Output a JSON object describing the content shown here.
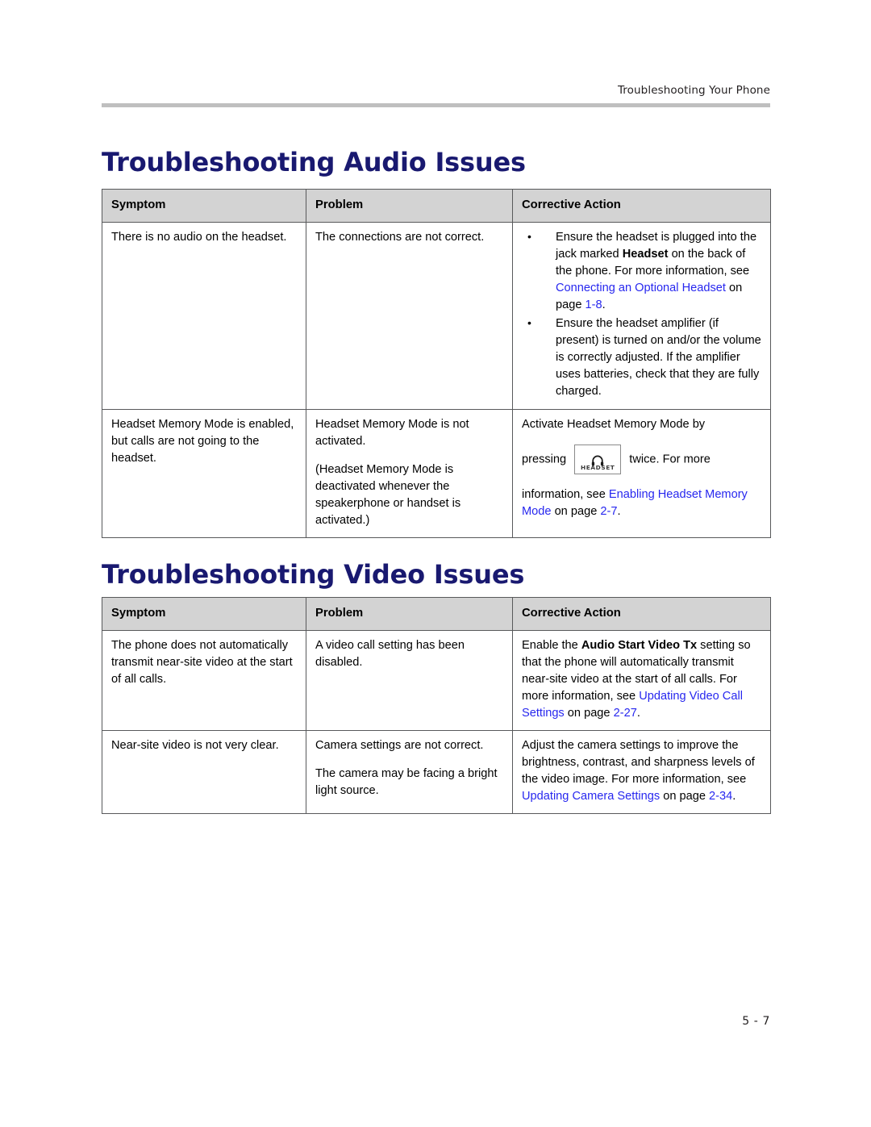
{
  "page": {
    "running_header": "Troubleshooting Your Phone",
    "folio": "5 - 7",
    "colors": {
      "heading_blue": "#191970",
      "link_blue": "#2727ef",
      "table_header_gray": "#d3d3d3",
      "rule_gray": "#bfbfbf",
      "border_gray": "#58595b"
    }
  },
  "sections": [
    {
      "heading": "Troubleshooting Audio Issues",
      "table": {
        "columns": [
          "Symptom",
          "Problem",
          "Corrective Action"
        ],
        "rows": [
          {
            "symptom": "There is no audio on the headset.",
            "problem": "The connections are not correct.",
            "action_bullets": [
              {
                "parts": [
                  {
                    "t": "Ensure the headset is plugged into the jack marked ",
                    "style": "normal"
                  },
                  {
                    "t": "Headset",
                    "style": "bold"
                  },
                  {
                    "t": " on the back of the phone. For more information, see ",
                    "style": "normal"
                  },
                  {
                    "t": "Connecting an Optional Headset",
                    "style": "link"
                  },
                  {
                    "t": " on page ",
                    "style": "normal"
                  },
                  {
                    "t": "1-8",
                    "style": "link"
                  },
                  {
                    "t": ".",
                    "style": "normal"
                  }
                ]
              },
              {
                "parts": [
                  {
                    "t": "Ensure the headset amplifier (if present) is turned on and/or the volume is correctly adjusted. If the amplifier uses batteries, check that they are fully charged.",
                    "style": "normal"
                  }
                ]
              }
            ]
          },
          {
            "symptom": "Headset Memory Mode is enabled, but calls are not going to the headset.",
            "problem_paragraphs": [
              "Headset Memory Mode is not activated.",
              "(Headset Memory Mode is deactivated whenever the speakerphone or handset is activated.)"
            ],
            "action_paragraphs": [
              {
                "parts": [
                  {
                    "t": "Activate Headset Memory Mode by",
                    "style": "normal"
                  }
                ]
              },
              {
                "parts": [
                  {
                    "t": "pressing ",
                    "style": "normal"
                  },
                  {
                    "t": "headset-key-icon",
                    "style": "key",
                    "key_label": "HEADSET"
                  },
                  {
                    "t": " twice. For more",
                    "style": "normal"
                  }
                ]
              },
              {
                "parts": [
                  {
                    "t": "information, see ",
                    "style": "normal"
                  },
                  {
                    "t": "Enabling Headset Memory Mode",
                    "style": "link"
                  },
                  {
                    "t": " on page ",
                    "style": "normal"
                  },
                  {
                    "t": "2-7",
                    "style": "link"
                  },
                  {
                    "t": ".",
                    "style": "normal"
                  }
                ]
              }
            ]
          }
        ]
      }
    },
    {
      "heading": "Troubleshooting Video Issues",
      "table": {
        "columns": [
          "Symptom",
          "Problem",
          "Corrective Action"
        ],
        "rows": [
          {
            "symptom": "The phone does not automatically transmit near-site video at the start of all calls.",
            "problem_paragraphs": [
              "A video call setting has been disabled."
            ],
            "action_paragraphs": [
              {
                "parts": [
                  {
                    "t": "Enable the ",
                    "style": "normal"
                  },
                  {
                    "t": "Audio Start Video Tx",
                    "style": "bold"
                  },
                  {
                    "t": " setting so that the phone will automatically transmit near-site video at the start of all calls. For more information, see ",
                    "style": "normal"
                  },
                  {
                    "t": "Updating Video Call Settings",
                    "style": "link"
                  },
                  {
                    "t": " on page ",
                    "style": "normal"
                  },
                  {
                    "t": "2-27",
                    "style": "link"
                  },
                  {
                    "t": ".",
                    "style": "normal"
                  }
                ]
              }
            ]
          },
          {
            "symptom": "Near-site video is not very clear.",
            "problem_paragraphs": [
              "Camera settings are not correct.",
              "The camera may be facing a bright light source."
            ],
            "action_paragraphs": [
              {
                "parts": [
                  {
                    "t": "Adjust the camera settings to improve the brightness, contrast, and sharpness levels of the video image. For more information, see ",
                    "style": "normal"
                  },
                  {
                    "t": "Updating Camera Settings",
                    "style": "link"
                  },
                  {
                    "t": " on page ",
                    "style": "normal"
                  },
                  {
                    "t": "2-34",
                    "style": "link"
                  },
                  {
                    "t": ".",
                    "style": "normal"
                  }
                ]
              }
            ]
          }
        ]
      }
    }
  ]
}
